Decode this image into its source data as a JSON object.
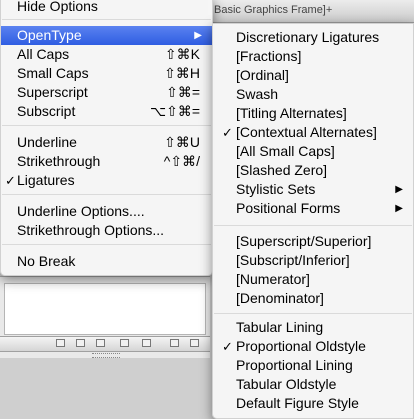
{
  "background": {
    "window_title": "Basic Graphics Frame]+"
  },
  "main_menu": {
    "hide_options": "Hide Options",
    "opentype": "OpenType",
    "opentype_arrow": "▶",
    "all_caps": "All Caps",
    "all_caps_shortcut": "⇧⌘K",
    "small_caps": "Small Caps",
    "small_caps_shortcut": "⇧⌘H",
    "superscript": "Superscript",
    "superscript_shortcut": "⇧⌘=",
    "subscript": "Subscript",
    "subscript_shortcut": "⌥⇧⌘=",
    "underline": "Underline",
    "underline_shortcut": "⇧⌘U",
    "strikethrough": "Strikethrough",
    "strikethrough_shortcut": "^⇧⌘/",
    "ligatures": "Ligatures",
    "ligatures_checked": "✓",
    "underline_options": "Underline Options....",
    "strikethrough_options": "Strikethrough Options...",
    "no_break": "No Break"
  },
  "opentype_menu": {
    "discretionary_ligatures": "Discretionary Ligatures",
    "fractions": "[Fractions]",
    "ordinal": "[Ordinal]",
    "swash": "Swash",
    "titling_alternates": "[Titling Alternates]",
    "contextual_alternates": "[Contextual Alternates]",
    "contextual_alternates_checked": "✓",
    "all_small_caps": "[All Small Caps]",
    "slashed_zero": "[Slashed Zero]",
    "stylistic_sets": "Stylistic Sets",
    "stylistic_sets_arrow": "▶",
    "positional_forms": "Positional Forms",
    "positional_forms_arrow": "▶",
    "superscript_superior": "[Superscript/Superior]",
    "subscript_inferior": "[Subscript/Inferior]",
    "numerator": "[Numerator]",
    "denominator": "[Denominator]",
    "tabular_lining": "Tabular Lining",
    "proportional_oldstyle": "Proportional Oldstyle",
    "proportional_oldstyle_checked": "✓",
    "proportional_lining": "Proportional Lining",
    "tabular_oldstyle": "Tabular Oldstyle",
    "default_figure_style": "Default Figure Style"
  },
  "colors": {
    "highlight": "#3d6ae6",
    "menu_background": "#f6f6f6"
  }
}
